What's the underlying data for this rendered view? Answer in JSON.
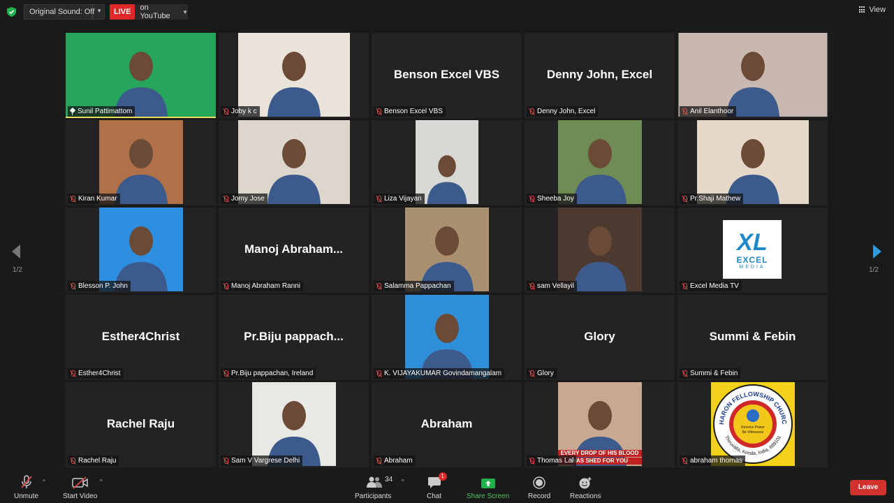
{
  "topbar": {
    "sound_label": "Original Sound: Off",
    "live_label": "LIVE",
    "live_target": "on YouTube",
    "view_label": "View"
  },
  "pagination": {
    "left": "1/2",
    "right": "1/2"
  },
  "participants": [
    {
      "name": "Sunil Pattimattom",
      "display": "",
      "video": true,
      "active": true,
      "pinned": true,
      "bg": "#26a65b",
      "w": 218
    },
    {
      "name": "Joby k c",
      "display": "",
      "video": true,
      "bg": "#e9e3d9",
      "w": 160
    },
    {
      "name": "Benson Excel VBS",
      "display": "Benson Excel VBS",
      "video": false
    },
    {
      "name": "Denny John, Excel",
      "display": "Denny John, Excel",
      "video": false
    },
    {
      "name": "Anil Elanthoor",
      "display": "",
      "video": true,
      "bg": "#c9b8b0",
      "w": 213
    },
    {
      "name": "Kiran Kumar",
      "display": "",
      "video": true,
      "bg": "#b07048",
      "w": 120
    },
    {
      "name": "Jomy Jose",
      "display": "",
      "video": true,
      "bg": "#dcd6cc",
      "w": 160
    },
    {
      "name": "Liza Vijayan",
      "display": "",
      "video": true,
      "bg": "#d8d8d4",
      "w": 90
    },
    {
      "name": "Sheeba Joy",
      "display": "",
      "video": true,
      "bg": "#6f8c54",
      "w": 120
    },
    {
      "name": "Pr.Shaji Mathew",
      "display": "",
      "video": true,
      "bg": "#e6d8c8",
      "w": 160
    },
    {
      "name": "Blesson P. John",
      "display": "",
      "video": true,
      "bg": "#2e8fe0",
      "w": 120
    },
    {
      "name": "Manoj Abraham Ranni",
      "display": "Manoj  Abraham...",
      "video": false
    },
    {
      "name": "Salamma Pappachan",
      "display": "",
      "video": true,
      "bg": "#a89070",
      "w": 120
    },
    {
      "name": "sam Vellayil",
      "display": "",
      "video": true,
      "bg": "#4c3a30",
      "w": 120
    },
    {
      "name": "Excel Media TV",
      "display": "",
      "video": true,
      "logo": true,
      "logo_text": "XL",
      "logo_sub": "EXCEL",
      "logo_sub2": "MEDIA"
    },
    {
      "name": "Esther4Christ",
      "display": "Esther4Christ",
      "video": false
    },
    {
      "name": "Pr.Biju pappachan, Ireland",
      "display": "Pr.Biju  pappach...",
      "video": false
    },
    {
      "name": "K. VIJAYAKUMAR Govindamangalam",
      "display": "",
      "video": true,
      "bg": "#2f8fd8",
      "w": 120
    },
    {
      "name": "Glory",
      "display": "Glory",
      "video": false
    },
    {
      "name": "Summi & Febin",
      "display": "Summi & Febin",
      "video": false
    },
    {
      "name": "Rachel Raju",
      "display": "Rachel Raju",
      "video": false
    },
    {
      "name": "Sam V Vargrese Delhi",
      "display": "",
      "video": true,
      "bg": "#e8e8e4",
      "w": 120
    },
    {
      "name": "Abraham",
      "display": "Abraham",
      "video": false
    },
    {
      "name": "Thomas Lal",
      "display": "",
      "video": true,
      "bg": "#c8a890",
      "w": 120,
      "caption1": "EVERY DROP OF HIS BLOOD",
      "caption2": "WAS SHED FOR YOU"
    },
    {
      "name": "abraham thomas",
      "display": "",
      "video": true,
      "seal": true,
      "seal_top": "SHARON FELLOWSHIP CHURCH",
      "seal_bottom": "Thiruvalla, Kerala, India, 689101",
      "seal_inner1": "Receive Power",
      "seal_inner2": "Be Witnesses"
    }
  ],
  "toolbar": {
    "unmute_label": "Unmute",
    "start_video_label": "Start Video",
    "participants_label": "Participants",
    "participants_count": "34",
    "chat_label": "Chat",
    "chat_badge": "1",
    "share_label": "Share Screen",
    "record_label": "Record",
    "reactions_label": "Reactions",
    "leave_label": "Leave"
  },
  "colors": {
    "live": "#e02828",
    "active_border": "#e3df5a",
    "share": "#4ec45e",
    "leave": "#d1322e",
    "muted": "#e24a4a"
  }
}
